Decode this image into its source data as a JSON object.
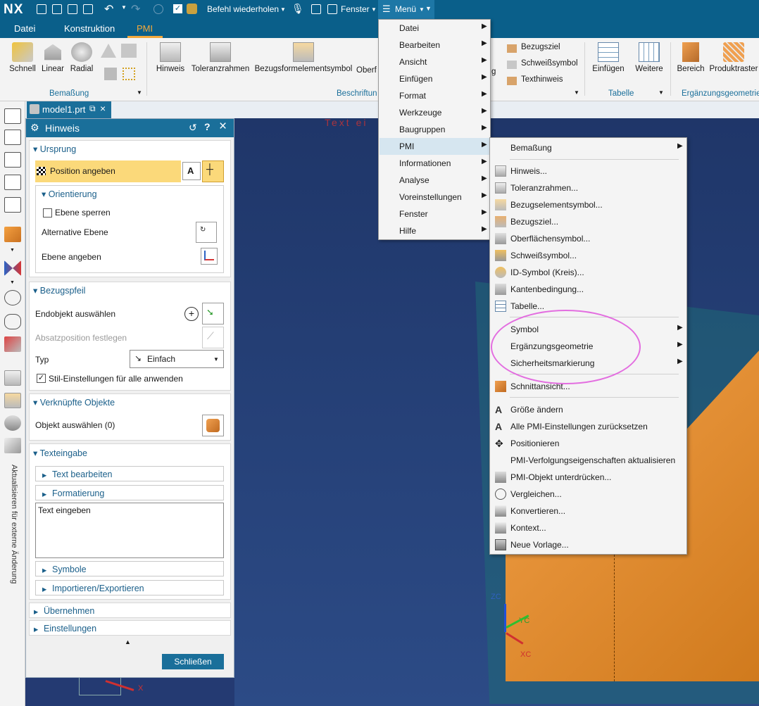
{
  "titlebar": {
    "logo": "NX",
    "befehl": "Befehl wiederholen",
    "fenster": "Fenster",
    "menu": "Menü"
  },
  "menutabs": [
    "Datei",
    "Konstruktion",
    "PMI"
  ],
  "ribbon": {
    "bemassung": {
      "items": [
        "Schnell",
        "Linear",
        "Radial"
      ],
      "group": "Bemaßung"
    },
    "beschriftung": {
      "items": [
        "Hinweis",
        "Toleranzrahmen",
        "Bezugsformelementsymbol",
        "Oberf"
      ],
      "group": "Beschriftun"
    },
    "hidden_items": [
      "Bezugsziel",
      "Schweißsymbol",
      "Texthinweis"
    ],
    "partial_g": "g",
    "tabelle": {
      "items": [
        "Einfügen",
        "Weitere"
      ],
      "group": "Tabelle"
    },
    "ergaenzung": {
      "items": [
        "Bereich",
        "Produktraster"
      ],
      "group": "Ergänzungsgeometrie"
    }
  },
  "doc_tab": "model1.prt",
  "viewport_text": "Text ei",
  "axis_labels": {
    "zc": "ZC",
    "yc": "YC",
    "xc": "XC",
    "x": "X"
  },
  "left_vertical_text": "Aktualisieren für externe Änderung",
  "panel": {
    "title": "Hinweis",
    "ursprung": {
      "head": "Ursprung",
      "position": "Position angeben"
    },
    "orientierung": {
      "head": "Orientierung",
      "ebene_sperren": "Ebene sperren",
      "alt_ebene": "Alternative Ebene",
      "ebene_angeben": "Ebene angeben"
    },
    "bezugspfeil": {
      "head": "Bezugspfeil",
      "endobjekt": "Endobjekt auswählen",
      "absatz": "Absatzposition festlegen",
      "typ": "Typ",
      "typ_value": "Einfach",
      "stil": "Stil-Einstellungen für alle anwenden"
    },
    "verknuepft": {
      "head": "Verknüpfte Objekte",
      "objekt": "Objekt auswählen (0)"
    },
    "texteingabe": {
      "head": "Texteingabe",
      "text_bearbeiten": "Text bearbeiten",
      "formatierung": "Formatierung",
      "textarea": "Text eingeben",
      "symbole": "Symbole",
      "import": "Importieren/Exportieren"
    },
    "uebernehmen": "Übernehmen",
    "einstellungen": "Einstellungen",
    "close": "Schließen"
  },
  "menu1": [
    "Datei",
    "Bearbeiten",
    "Ansicht",
    "Einfügen",
    "Format",
    "Werkzeuge",
    "Baugruppen",
    "PMI",
    "Informationen",
    "Analyse",
    "Voreinstellungen",
    "Fenster",
    "Hilfe"
  ],
  "menu2": {
    "bemassung": "Bemaßung",
    "group1": [
      "Hinweis...",
      "Toleranzrahmen...",
      "Bezugselementsymbol...",
      "Bezugsziel...",
      "Oberflächensymbol...",
      "Schweißsymbol...",
      "ID-Symbol (Kreis)...",
      "Kantenbedingung...",
      "Tabelle..."
    ],
    "group2": [
      "Symbol",
      "Ergänzungsgeometrie",
      "Sicherheitsmarkierung"
    ],
    "group3": [
      "Schnittansicht..."
    ],
    "group4": [
      "Größe ändern",
      "Alle PMI-Einstellungen zurücksetzen",
      "Positionieren",
      "PMI-Verfolgungseigenschaften aktualisieren",
      "PMI-Objekt unterdrücken...",
      "Vergleichen...",
      "Konvertieren...",
      "Kontext...",
      "Neue Vorlage..."
    ]
  },
  "colors": {
    "accent": "#0a5f8a",
    "highlight": "#fbd97a",
    "pmi_tab": "#f3a83b",
    "annotation": "#e36ee0"
  }
}
